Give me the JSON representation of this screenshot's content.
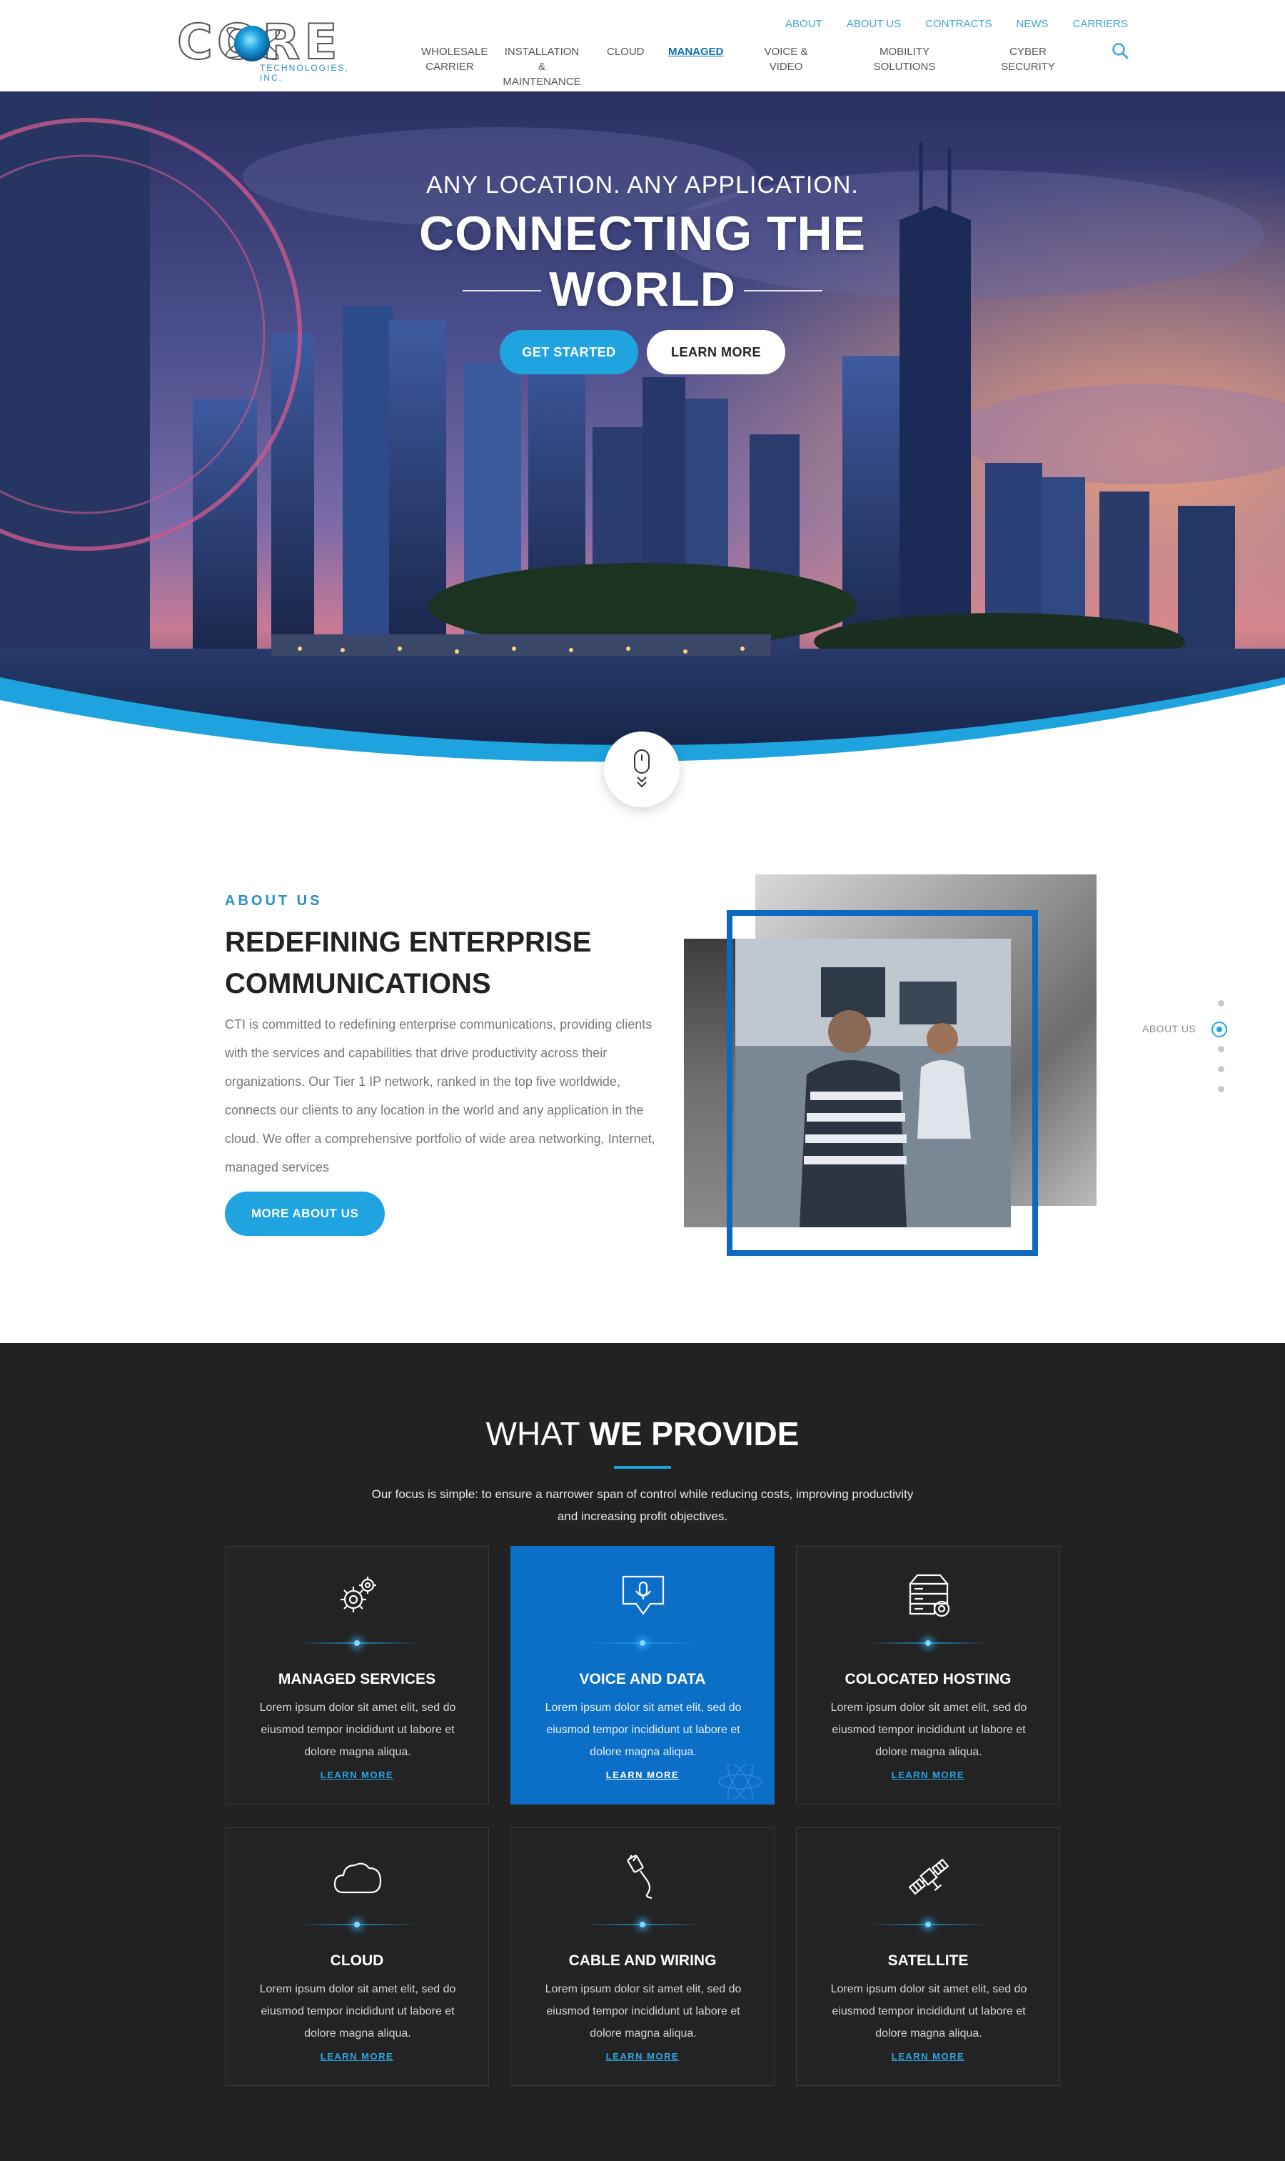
{
  "brand": {
    "logo_text": "CORE",
    "logo_sub": "TECHNOLOGIES, INC."
  },
  "top_nav": [
    "About",
    "About Us",
    "Contracts",
    "News",
    "Carriers"
  ],
  "main_nav": [
    {
      "label": "Wholesale\nCarrier",
      "active": false
    },
    {
      "label": "Installation &\nMaintenance",
      "active": false
    },
    {
      "label": "Cloud",
      "active": false
    },
    {
      "label": "Managed",
      "active": true
    },
    {
      "label": "Voice & Video",
      "active": false
    },
    {
      "label": "Mobility Solutions",
      "active": false
    },
    {
      "label": "Cyber Security",
      "active": false
    }
  ],
  "hero": {
    "eyebrow": "ANY LOCATION. ANY APPLICATION.",
    "title_line1": "CONNECTING THE",
    "title_line2": "WORLD",
    "btn_primary": "Get Started",
    "btn_secondary": "Learn More"
  },
  "about": {
    "eyebrow": "About Us",
    "title": "Redefining Enterprise Communications",
    "body": "CTI is committed to redefining enterprise communications, providing clients with the services and capabilities that drive productivity across their organizations. Our Tier 1 IP network, ranked in the top five worldwide, connects our clients to any location in the world and any application in the cloud. We offer a comprehensive portfolio of wide area networking, Internet, managed services",
    "button": "More About Us",
    "side_label": "About Us"
  },
  "services": {
    "title_light": "WHAT",
    "title_bold": "WE PROVIDE",
    "intro": "Our focus is simple: to ensure a narrower span of control while reducing costs, improving productivity and increasing profit objectives.",
    "cards": [
      {
        "title": "Managed Services",
        "icon": "gears-icon",
        "text": "Lorem ipsum dolor sit amet elit, sed do eiusmod tempor incididunt ut labore et dolore magna aliqua.",
        "link": "Learn More",
        "featured": false
      },
      {
        "title": "Voice and Data",
        "icon": "voice-message-icon",
        "text": "Lorem ipsum dolor sit amet elit, sed do eiusmod tempor incididunt ut labore et dolore magna aliqua.",
        "link": "Learn More",
        "featured": true
      },
      {
        "title": "Colocated Hosting",
        "icon": "server-icon",
        "text": "Lorem ipsum dolor sit amet elit, sed do eiusmod tempor incididunt ut labore et dolore magna aliqua.",
        "link": "Learn More",
        "featured": false
      },
      {
        "title": "Cloud",
        "icon": "cloud-icon",
        "text": "Lorem ipsum dolor sit amet elit, sed do eiusmod tempor incididunt ut labore et dolore magna aliqua.",
        "link": "Learn More",
        "featured": false
      },
      {
        "title": "Cable and Wiring",
        "icon": "cable-icon",
        "text": "Lorem ipsum dolor sit amet elit, sed do eiusmod tempor incididunt ut labore et dolore magna aliqua.",
        "link": "Learn More",
        "featured": false
      },
      {
        "title": "Satellite",
        "icon": "satellite-icon",
        "text": "Lorem ipsum dolor sit amet elit, sed do eiusmod tempor incididunt ut labore et dolore magna aliqua.",
        "link": "Learn More",
        "featured": false
      }
    ]
  },
  "colors": {
    "accent": "#1fa4e0",
    "primary_blue": "#0b6ec7",
    "dark_bg": "#222223",
    "nav_link": "#3ba6d8"
  }
}
